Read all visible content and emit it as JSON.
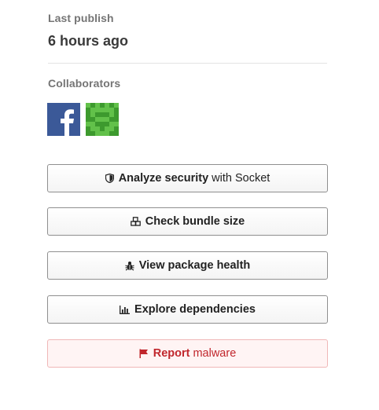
{
  "last_publish": {
    "label": "Last publish",
    "value": "6 hours ago"
  },
  "collaborators": {
    "label": "Collaborators",
    "avatars": [
      {
        "name": "facebook-logo",
        "color": "#3b5998"
      },
      {
        "name": "identicon",
        "color": "#3d9a2e"
      }
    ]
  },
  "actions": {
    "security": {
      "strong": "Analyze security",
      "light": "with Socket",
      "icon": "shield-icon"
    },
    "bundle": {
      "strong": "Check bundle size",
      "icon": "boxes-icon"
    },
    "health": {
      "strong": "View package health",
      "icon": "bug-icon"
    },
    "deps": {
      "strong": "Explore dependencies",
      "icon": "chart-icon"
    },
    "report": {
      "strong": "Report",
      "light": "malware",
      "icon": "flag-icon",
      "color": "#c1272d"
    }
  }
}
